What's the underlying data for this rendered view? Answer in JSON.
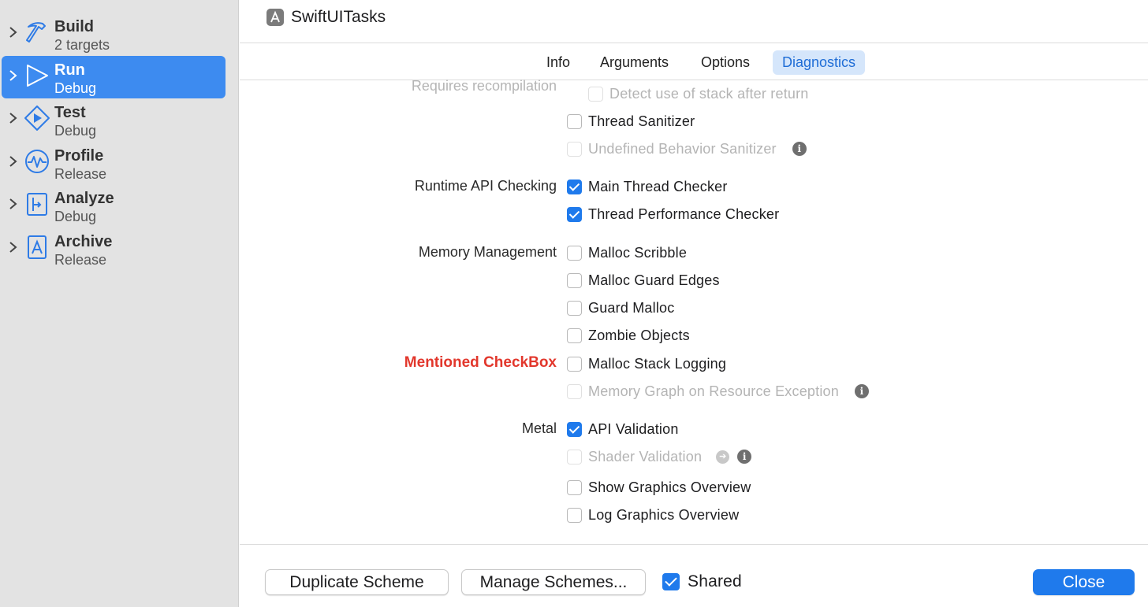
{
  "sidebar": {
    "actions": [
      {
        "title": "Build",
        "subtitle": "2 targets",
        "icon": "hammer-icon",
        "selected": false
      },
      {
        "title": "Run",
        "subtitle": "Debug",
        "icon": "play-outline-icon",
        "selected": true
      },
      {
        "title": "Test",
        "subtitle": "Debug",
        "icon": "test-diamond-icon",
        "selected": false
      },
      {
        "title": "Profile",
        "subtitle": "Release",
        "icon": "waveform-gauge-icon",
        "selected": false
      },
      {
        "title": "Analyze",
        "subtitle": "Debug",
        "icon": "analyze-icon",
        "selected": false
      },
      {
        "title": "Archive",
        "subtitle": "Release",
        "icon": "archive-app-icon",
        "selected": false
      }
    ]
  },
  "header": {
    "app_name": "SwiftUITasks",
    "app_icon": "app-target-icon"
  },
  "tabs": [
    {
      "label": "Info",
      "active": false
    },
    {
      "label": "Arguments",
      "active": false
    },
    {
      "label": "Options",
      "active": false
    },
    {
      "label": "Diagnostics",
      "active": true
    }
  ],
  "diagnostics": {
    "requires_recompilation_label": "Requires recompilation",
    "detect_stack_after_return": {
      "label": "Detect use of stack after return",
      "checked": false,
      "enabled": false
    },
    "thread_sanitizer": {
      "label": "Thread Sanitizer",
      "checked": false,
      "enabled": true
    },
    "undefined_behavior_sanitizer": {
      "label": "Undefined Behavior Sanitizer",
      "checked": false,
      "enabled": false
    },
    "runtime_api_label": "Runtime API Checking",
    "main_thread_checker": {
      "label": "Main Thread Checker",
      "checked": true,
      "enabled": true
    },
    "thread_performance_checker": {
      "label": "Thread Performance Checker",
      "checked": true,
      "enabled": true
    },
    "memory_management_label": "Memory Management",
    "malloc_scribble": {
      "label": "Malloc Scribble",
      "checked": false,
      "enabled": true
    },
    "malloc_guard_edges": {
      "label": "Malloc Guard Edges",
      "checked": false,
      "enabled": true
    },
    "guard_malloc": {
      "label": "Guard Malloc",
      "checked": false,
      "enabled": true
    },
    "zombie_objects": {
      "label": "Zombie Objects",
      "checked": false,
      "enabled": true
    },
    "annotation_label": "Mentioned CheckBox",
    "malloc_stack_logging": {
      "label": "Malloc Stack Logging",
      "checked": false,
      "enabled": true
    },
    "memory_graph_resource_exception": {
      "label": "Memory Graph on Resource Exception",
      "checked": false,
      "enabled": false
    },
    "metal_label": "Metal",
    "api_validation": {
      "label": "API Validation",
      "checked": true,
      "enabled": true
    },
    "shader_validation": {
      "label": "Shader Validation",
      "checked": false,
      "enabled": false
    },
    "show_graphics_overview": {
      "label": "Show Graphics Overview",
      "checked": false,
      "enabled": true
    },
    "log_graphics_overview": {
      "label": "Log Graphics Overview",
      "checked": false,
      "enabled": true
    }
  },
  "footer": {
    "duplicate_scheme_label": "Duplicate Scheme",
    "manage_schemes_label": "Manage Schemes...",
    "shared_label": "Shared",
    "shared_checked": true,
    "close_label": "Close"
  },
  "colors": {
    "accent": "#1f7aec",
    "sidebar_selected": "#3d8bf0",
    "tab_active_bg": "#d5e6fb",
    "annotation_red": "#e2372c",
    "sidebar_bg": "#e3e3e3"
  },
  "icons": {
    "info": "info-icon",
    "arrow": "arrow-right-circle-icon",
    "chevron": "chevron-right-icon"
  }
}
